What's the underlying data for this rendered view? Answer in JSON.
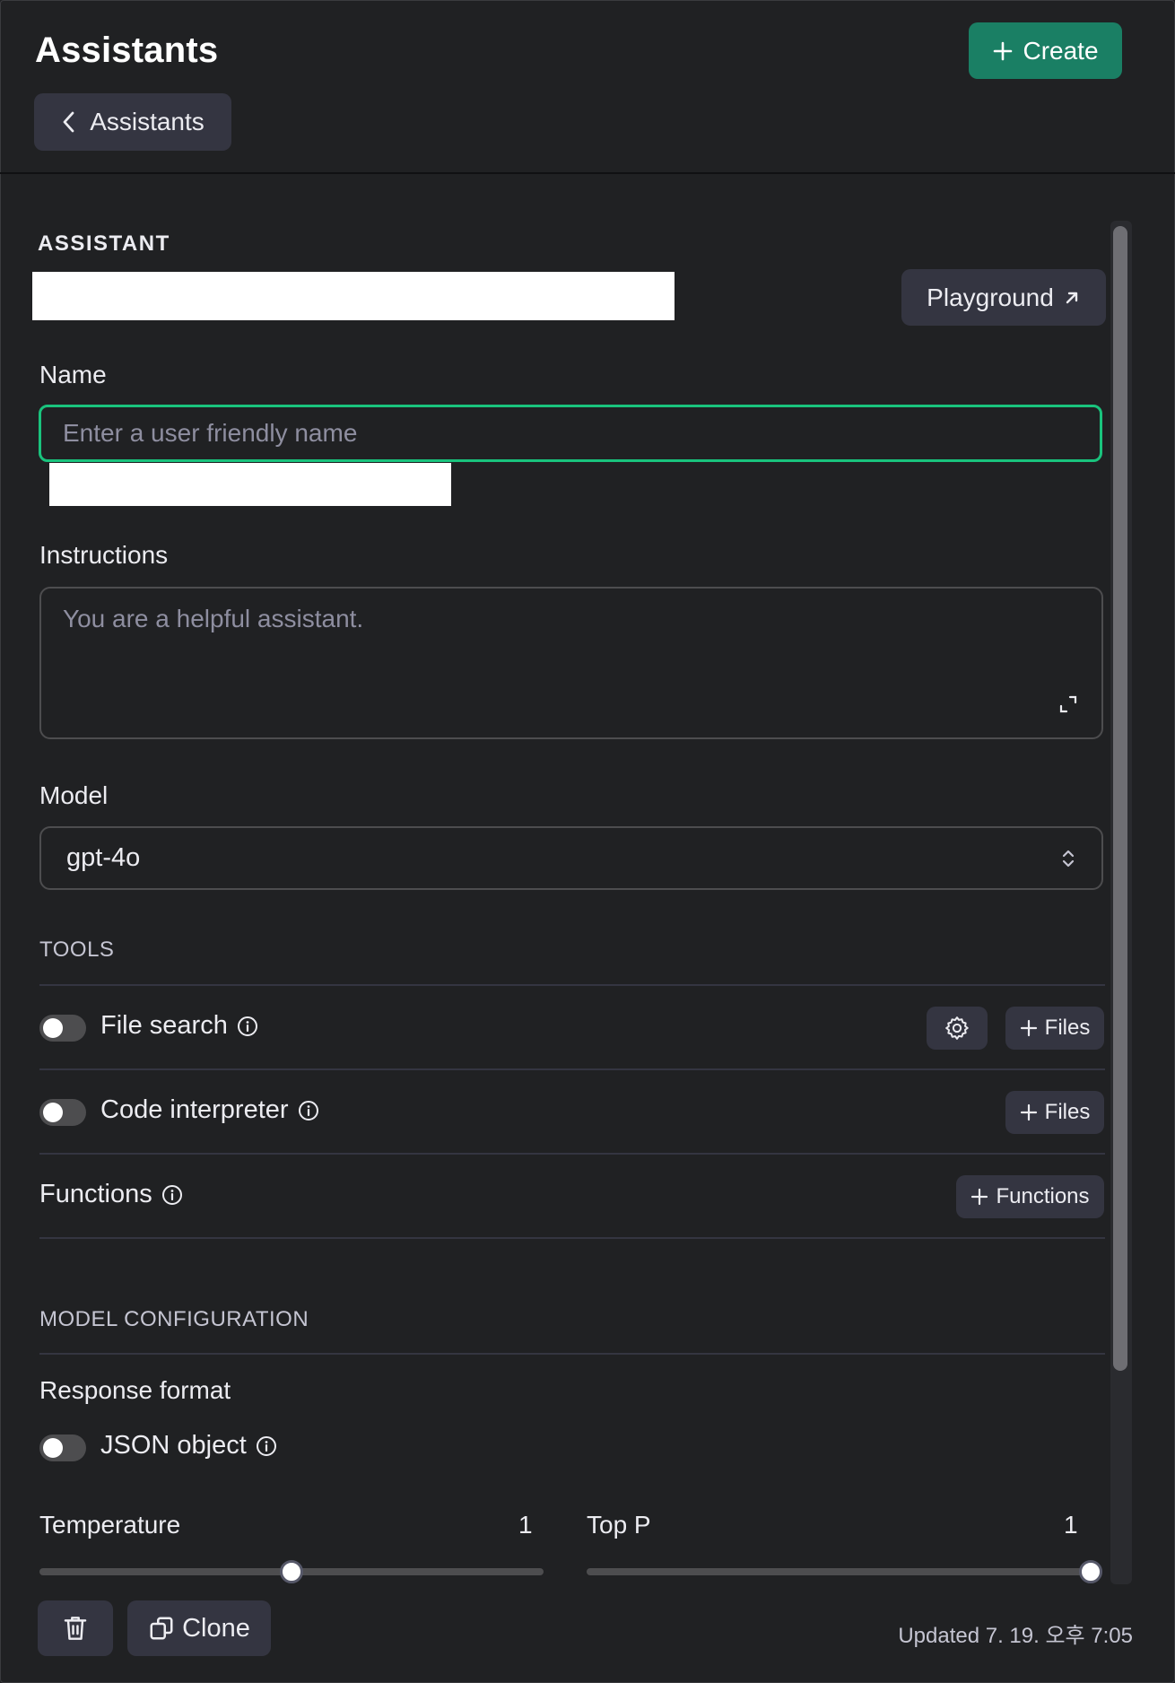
{
  "header": {
    "title": "Assistants",
    "create_label": "Create",
    "back_label": "Assistants"
  },
  "assistant": {
    "section_label": "ASSISTANT",
    "playground_label": "Playground"
  },
  "form": {
    "name_label": "Name",
    "name_placeholder": "Enter a user friendly name",
    "instructions_label": "Instructions",
    "instructions_placeholder": "You are a helpful assistant.",
    "model_label": "Model",
    "model_value": "gpt-4o"
  },
  "tools": {
    "section_label": "TOOLS",
    "items": [
      {
        "label": "File search",
        "enabled": false,
        "files_label": "Files"
      },
      {
        "label": "Code interpreter",
        "enabled": false,
        "files_label": "Files"
      }
    ],
    "functions_label": "Functions",
    "functions_button_label": "Functions"
  },
  "model_config": {
    "section_label": "MODEL CONFIGURATION",
    "response_format_label": "Response format",
    "json_object_label": "JSON object",
    "json_object_enabled": false,
    "temperature_label": "Temperature",
    "temperature_value": "1",
    "temperature_fraction": 0.5,
    "top_p_label": "Top P",
    "top_p_value": "1",
    "top_p_fraction": 1.0
  },
  "footer": {
    "clone_label": "Clone",
    "updated_text": "Updated 7. 19. 오후 7:05"
  },
  "colors": {
    "background": "#202123",
    "accent": "#1a7f64",
    "focus": "#19c37d",
    "button_bg": "#343541"
  }
}
